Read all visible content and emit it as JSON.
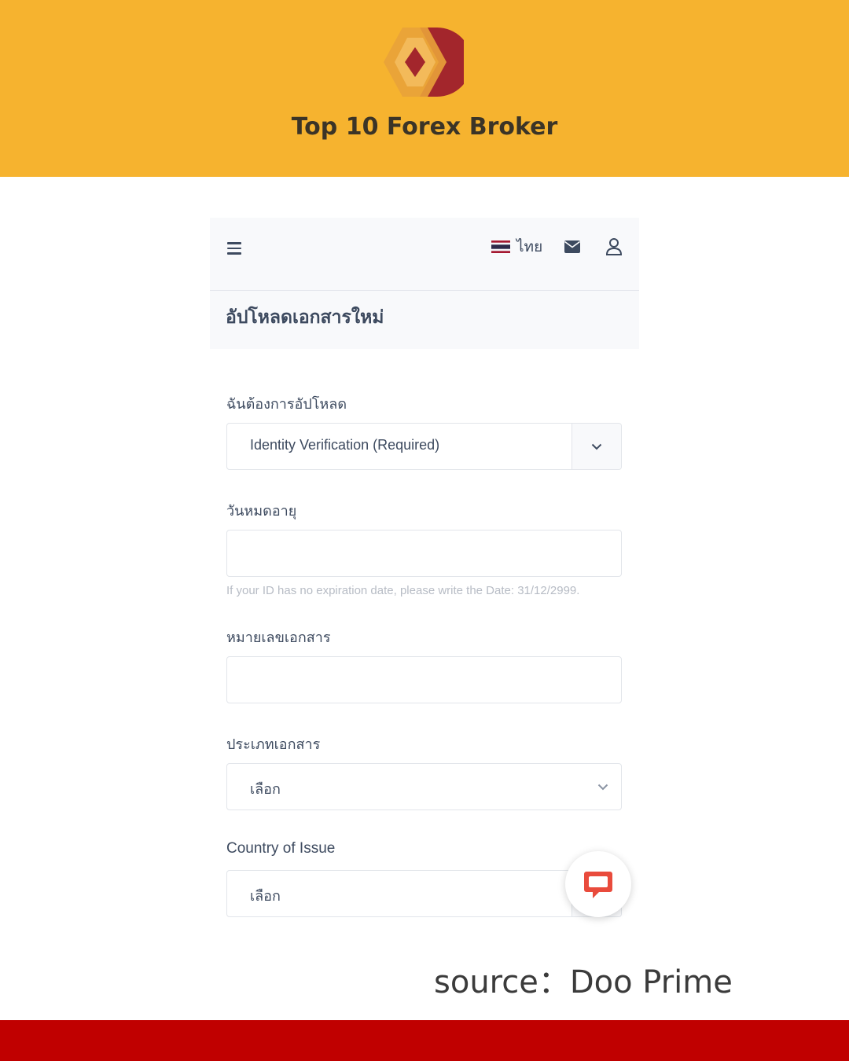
{
  "brand": {
    "title": "Top 10 Forex Broker",
    "logo_icon": "doo-prime-logo",
    "color_banner": "#f6b32f",
    "color_footer": "#c00000"
  },
  "topbar": {
    "menu_icon": "hamburger-icon",
    "language_label": "ไทย",
    "flag_icon": "thai-flag-icon",
    "mail_icon": "mail-icon",
    "user_icon": "user-icon"
  },
  "page": {
    "title": "อัปโหลดเอกสารใหม่"
  },
  "form": {
    "upload_type": {
      "label": "ฉันต้องการอัปโหลด",
      "value": "Identity Verification (Required)"
    },
    "expiry": {
      "label": "วันหมดอายุ",
      "value": "",
      "hint": "If your ID has no expiration date, please write the Date: 31/12/2999."
    },
    "doc_number": {
      "label": "หมายเลขเอกสาร",
      "value": ""
    },
    "doc_type": {
      "label": "ประเภทเอกสาร",
      "value": "เลือก"
    },
    "country": {
      "label": "Country of Issue",
      "value": "เลือก"
    }
  },
  "chat": {
    "icon": "chat-bubble-icon",
    "color": "#e94b3c"
  },
  "source_caption": "source：Doo Prime"
}
